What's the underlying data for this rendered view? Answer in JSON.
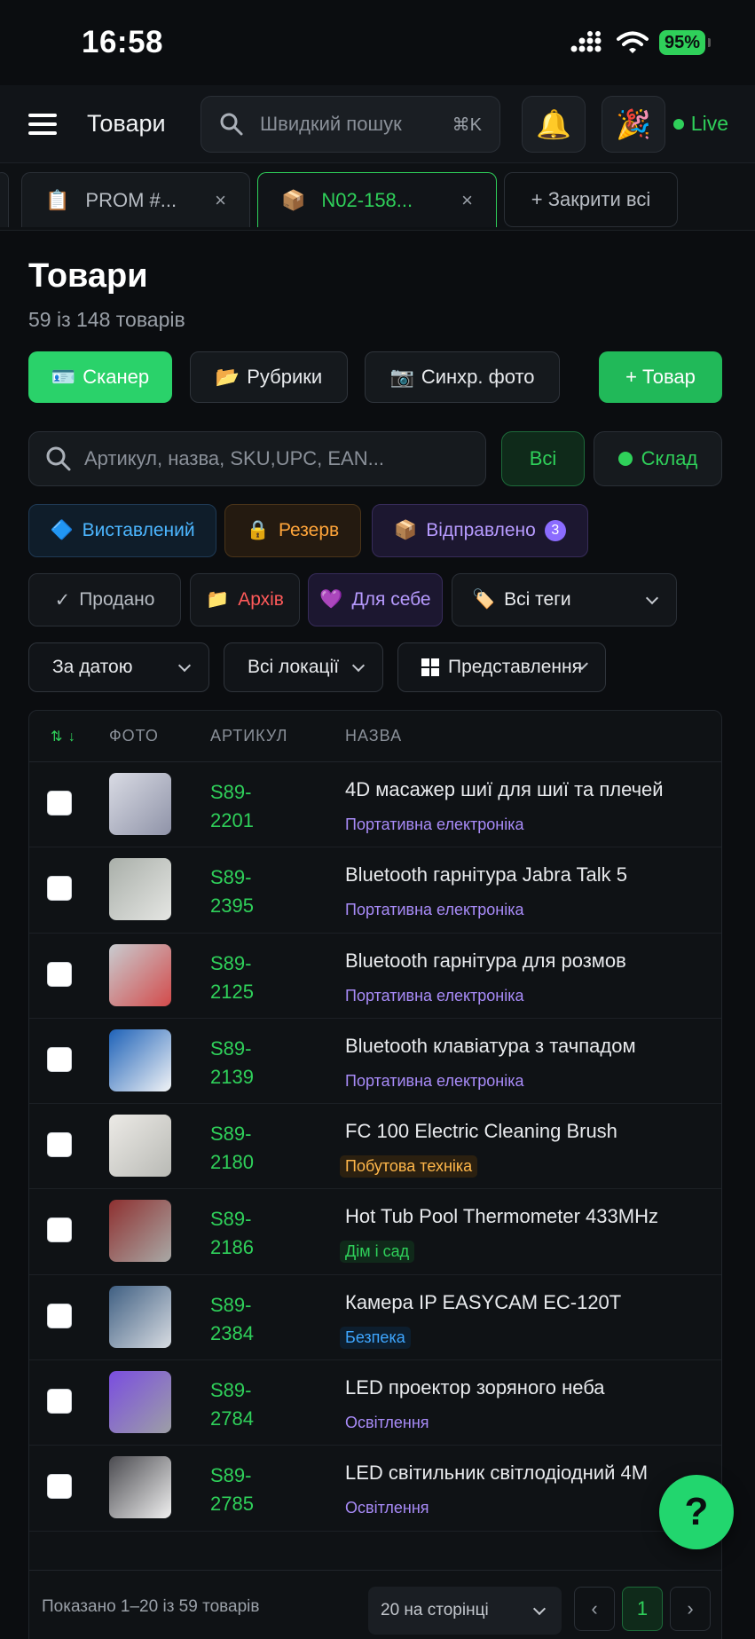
{
  "status_bar": {
    "time": "16:58",
    "battery": "95"
  },
  "topbar": {
    "title": "Товари",
    "search_placeholder": "Швидкий пошук",
    "search_shortcut": "⌘K",
    "live_label": "Live"
  },
  "tabs": [
    {
      "label": "PROM #...",
      "close": "×"
    },
    {
      "label": "N02-158...",
      "close": "×"
    }
  ],
  "close_all_label": "+ Закрити всі",
  "page": {
    "title": "Товари",
    "subtitle": "59 із 148 товарів"
  },
  "actions": {
    "scanner": "Сканер",
    "categories": "Рубрики",
    "sync_photo": "Синхр. фото",
    "add_product": "+ Товар"
  },
  "filter": {
    "search_placeholder": "Артикул, назва, SKU,UPC, EAN...",
    "all": "Всі",
    "stock": "Склад"
  },
  "status_chips": {
    "listed": "Виставлений",
    "reserved": "Резерв",
    "shipped": "Відправлено",
    "shipped_count": "3",
    "sold": "Продано",
    "archive": "Архів",
    "for_self": "Для себе",
    "all_tags": "Всі теги"
  },
  "dropdowns": {
    "by_date": "За датою",
    "all_locations": "Всі локації",
    "view": "Представлення"
  },
  "table": {
    "columns": {
      "photo": "ФОТО",
      "sku": "АРТИКУЛ",
      "name": "НАЗВА"
    },
    "rows": [
      {
        "sku": "S89-2201",
        "name": "4D масажер шиї для шиї та плечей",
        "category": "Портативна електроніка",
        "cat_color": "purple"
      },
      {
        "sku": "S89-2395",
        "name": "Bluetooth гарнітура Jabra Talk 5",
        "category": "Портативна електроніка",
        "cat_color": "purple"
      },
      {
        "sku": "S89-2125",
        "name": "Bluetooth гарнітура для розмов",
        "category": "Портативна електроніка",
        "cat_color": "purple"
      },
      {
        "sku": "S89-2139",
        "name": "Bluetooth клавіатура з тачпадом",
        "category": "Портативна електроніка",
        "cat_color": "purple"
      },
      {
        "sku": "S89-2180",
        "name": "FC 100 Electric Cleaning Brush",
        "category": "Побутова техніка",
        "cat_color": "orange"
      },
      {
        "sku": "S89-2186",
        "name": "Hot Tub Pool Thermometer 433MHz",
        "category": "Дім і сад",
        "cat_color": "green"
      },
      {
        "sku": "S89-2384",
        "name": "Камера IP EASYCAM EC-120T",
        "category": "Безпека",
        "cat_color": "blue"
      },
      {
        "sku": "S89-2784",
        "name": "LED проектор зоряного неба",
        "category": "Освітлення",
        "cat_color": "purple"
      },
      {
        "sku": "S89-2785",
        "name": "LED світильник світлодіодний 4M",
        "category": "Освітлення",
        "cat_color": "purple"
      }
    ]
  },
  "footer": {
    "info": "Показано 1–20 із 59 товарів",
    "per_page": "20 на сторінці",
    "current_page": "1"
  },
  "help_label": "?",
  "colors": {
    "accent": "#2fd05a",
    "background": "#0b0d10"
  }
}
